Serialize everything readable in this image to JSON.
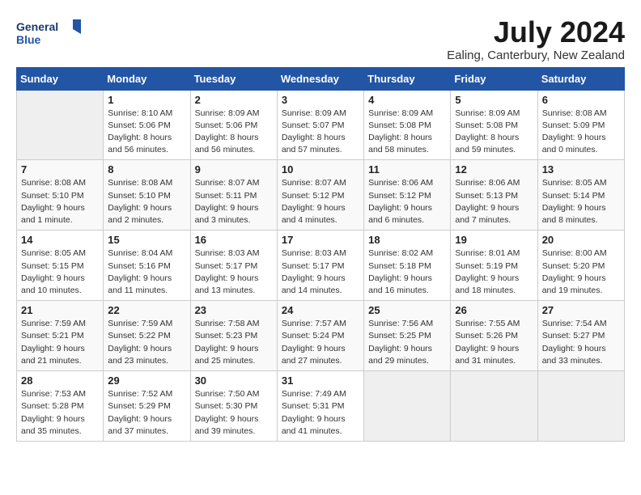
{
  "header": {
    "logo_line1": "General",
    "logo_line2": "Blue",
    "month": "July 2024",
    "location": "Ealing, Canterbury, New Zealand"
  },
  "weekdays": [
    "Sunday",
    "Monday",
    "Tuesday",
    "Wednesday",
    "Thursday",
    "Friday",
    "Saturday"
  ],
  "weeks": [
    [
      {
        "day": "",
        "empty": true
      },
      {
        "day": "1",
        "sunrise": "Sunrise: 8:10 AM",
        "sunset": "Sunset: 5:06 PM",
        "daylight": "Daylight: 8 hours and 56 minutes."
      },
      {
        "day": "2",
        "sunrise": "Sunrise: 8:09 AM",
        "sunset": "Sunset: 5:06 PM",
        "daylight": "Daylight: 8 hours and 56 minutes."
      },
      {
        "day": "3",
        "sunrise": "Sunrise: 8:09 AM",
        "sunset": "Sunset: 5:07 PM",
        "daylight": "Daylight: 8 hours and 57 minutes."
      },
      {
        "day": "4",
        "sunrise": "Sunrise: 8:09 AM",
        "sunset": "Sunset: 5:08 PM",
        "daylight": "Daylight: 8 hours and 58 minutes."
      },
      {
        "day": "5",
        "sunrise": "Sunrise: 8:09 AM",
        "sunset": "Sunset: 5:08 PM",
        "daylight": "Daylight: 8 hours and 59 minutes."
      },
      {
        "day": "6",
        "sunrise": "Sunrise: 8:08 AM",
        "sunset": "Sunset: 5:09 PM",
        "daylight": "Daylight: 9 hours and 0 minutes."
      }
    ],
    [
      {
        "day": "7",
        "sunrise": "Sunrise: 8:08 AM",
        "sunset": "Sunset: 5:10 PM",
        "daylight": "Daylight: 9 hours and 1 minute."
      },
      {
        "day": "8",
        "sunrise": "Sunrise: 8:08 AM",
        "sunset": "Sunset: 5:10 PM",
        "daylight": "Daylight: 9 hours and 2 minutes."
      },
      {
        "day": "9",
        "sunrise": "Sunrise: 8:07 AM",
        "sunset": "Sunset: 5:11 PM",
        "daylight": "Daylight: 9 hours and 3 minutes."
      },
      {
        "day": "10",
        "sunrise": "Sunrise: 8:07 AM",
        "sunset": "Sunset: 5:12 PM",
        "daylight": "Daylight: 9 hours and 4 minutes."
      },
      {
        "day": "11",
        "sunrise": "Sunrise: 8:06 AM",
        "sunset": "Sunset: 5:12 PM",
        "daylight": "Daylight: 9 hours and 6 minutes."
      },
      {
        "day": "12",
        "sunrise": "Sunrise: 8:06 AM",
        "sunset": "Sunset: 5:13 PM",
        "daylight": "Daylight: 9 hours and 7 minutes."
      },
      {
        "day": "13",
        "sunrise": "Sunrise: 8:05 AM",
        "sunset": "Sunset: 5:14 PM",
        "daylight": "Daylight: 9 hours and 8 minutes."
      }
    ],
    [
      {
        "day": "14",
        "sunrise": "Sunrise: 8:05 AM",
        "sunset": "Sunset: 5:15 PM",
        "daylight": "Daylight: 9 hours and 10 minutes."
      },
      {
        "day": "15",
        "sunrise": "Sunrise: 8:04 AM",
        "sunset": "Sunset: 5:16 PM",
        "daylight": "Daylight: 9 hours and 11 minutes."
      },
      {
        "day": "16",
        "sunrise": "Sunrise: 8:03 AM",
        "sunset": "Sunset: 5:17 PM",
        "daylight": "Daylight: 9 hours and 13 minutes."
      },
      {
        "day": "17",
        "sunrise": "Sunrise: 8:03 AM",
        "sunset": "Sunset: 5:17 PM",
        "daylight": "Daylight: 9 hours and 14 minutes."
      },
      {
        "day": "18",
        "sunrise": "Sunrise: 8:02 AM",
        "sunset": "Sunset: 5:18 PM",
        "daylight": "Daylight: 9 hours and 16 minutes."
      },
      {
        "day": "19",
        "sunrise": "Sunrise: 8:01 AM",
        "sunset": "Sunset: 5:19 PM",
        "daylight": "Daylight: 9 hours and 18 minutes."
      },
      {
        "day": "20",
        "sunrise": "Sunrise: 8:00 AM",
        "sunset": "Sunset: 5:20 PM",
        "daylight": "Daylight: 9 hours and 19 minutes."
      }
    ],
    [
      {
        "day": "21",
        "sunrise": "Sunrise: 7:59 AM",
        "sunset": "Sunset: 5:21 PM",
        "daylight": "Daylight: 9 hours and 21 minutes."
      },
      {
        "day": "22",
        "sunrise": "Sunrise: 7:59 AM",
        "sunset": "Sunset: 5:22 PM",
        "daylight": "Daylight: 9 hours and 23 minutes."
      },
      {
        "day": "23",
        "sunrise": "Sunrise: 7:58 AM",
        "sunset": "Sunset: 5:23 PM",
        "daylight": "Daylight: 9 hours and 25 minutes."
      },
      {
        "day": "24",
        "sunrise": "Sunrise: 7:57 AM",
        "sunset": "Sunset: 5:24 PM",
        "daylight": "Daylight: 9 hours and 27 minutes."
      },
      {
        "day": "25",
        "sunrise": "Sunrise: 7:56 AM",
        "sunset": "Sunset: 5:25 PM",
        "daylight": "Daylight: 9 hours and 29 minutes."
      },
      {
        "day": "26",
        "sunrise": "Sunrise: 7:55 AM",
        "sunset": "Sunset: 5:26 PM",
        "daylight": "Daylight: 9 hours and 31 minutes."
      },
      {
        "day": "27",
        "sunrise": "Sunrise: 7:54 AM",
        "sunset": "Sunset: 5:27 PM",
        "daylight": "Daylight: 9 hours and 33 minutes."
      }
    ],
    [
      {
        "day": "28",
        "sunrise": "Sunrise: 7:53 AM",
        "sunset": "Sunset: 5:28 PM",
        "daylight": "Daylight: 9 hours and 35 minutes."
      },
      {
        "day": "29",
        "sunrise": "Sunrise: 7:52 AM",
        "sunset": "Sunset: 5:29 PM",
        "daylight": "Daylight: 9 hours and 37 minutes."
      },
      {
        "day": "30",
        "sunrise": "Sunrise: 7:50 AM",
        "sunset": "Sunset: 5:30 PM",
        "daylight": "Daylight: 9 hours and 39 minutes."
      },
      {
        "day": "31",
        "sunrise": "Sunrise: 7:49 AM",
        "sunset": "Sunset: 5:31 PM",
        "daylight": "Daylight: 9 hours and 41 minutes."
      },
      {
        "day": "",
        "empty": true
      },
      {
        "day": "",
        "empty": true
      },
      {
        "day": "",
        "empty": true
      }
    ]
  ]
}
